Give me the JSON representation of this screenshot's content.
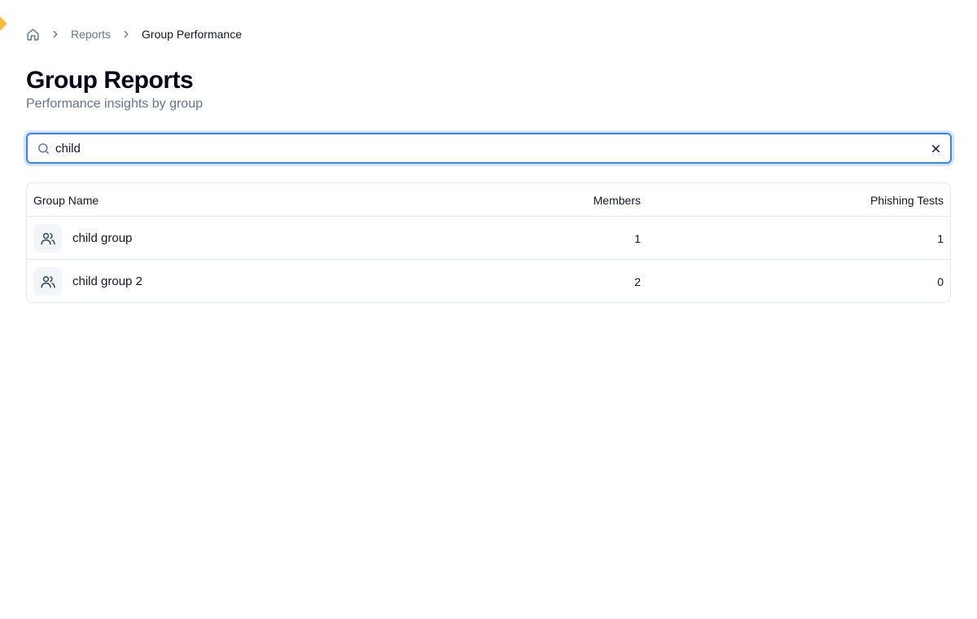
{
  "breadcrumb": {
    "home_icon": "home-icon",
    "separator_icon": "chevron-right-icon",
    "items": [
      "Reports",
      "Group Performance"
    ]
  },
  "header": {
    "title": "Group Reports",
    "subtitle": "Performance insights by group"
  },
  "search": {
    "value": "child",
    "icon": "search-icon",
    "clear_icon": "close-icon"
  },
  "table": {
    "columns": {
      "name": "Group Name",
      "members": "Members",
      "tests": "Phishing Tests"
    },
    "rows": [
      {
        "name": "child group",
        "members": "1",
        "tests": "1",
        "icon": "users-icon"
      },
      {
        "name": "child group 2",
        "members": "2",
        "tests": "0",
        "icon": "users-icon"
      }
    ]
  },
  "colors": {
    "accent": "#3b82f6",
    "text": "#0f172a",
    "muted": "#64748b",
    "border": "#e2e8f0",
    "edge_accent": "#f5b942"
  }
}
